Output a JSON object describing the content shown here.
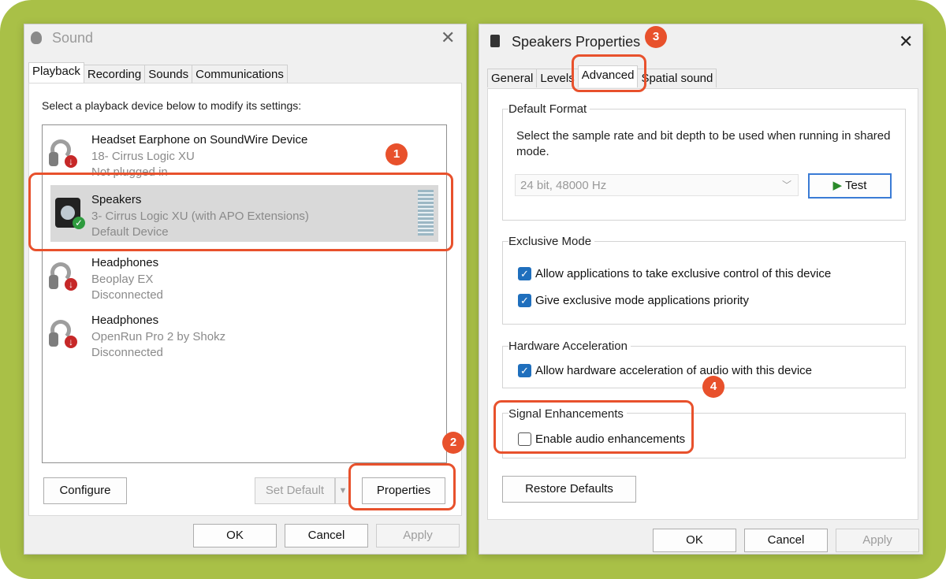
{
  "sound_window": {
    "title": "Sound",
    "tabs": [
      "Playback",
      "Recording",
      "Sounds",
      "Communications"
    ],
    "instruction": "Select a playback device below to modify its settings:",
    "devices": [
      {
        "name": "Headset Earphone on SoundWire Device",
        "line2": "18- Cirrus Logic XU",
        "line3": "Not plugged in"
      },
      {
        "name": "Speakers",
        "line2": "3- Cirrus Logic XU (with APO Extensions)",
        "line3": "Default Device"
      },
      {
        "name": "Headphones",
        "line2": "Beoplay EX",
        "line3": "Disconnected"
      },
      {
        "name": "Headphones",
        "line2": "OpenRun Pro 2 by Shokz",
        "line3": "Disconnected"
      }
    ],
    "buttons": {
      "configure": "Configure",
      "set_default": "Set Default",
      "properties": "Properties"
    },
    "footer": {
      "ok": "OK",
      "cancel": "Cancel",
      "apply": "Apply"
    }
  },
  "speakers_window": {
    "title": "Speakers Properties",
    "tabs": [
      "General",
      "Levels",
      "Advanced",
      "Spatial sound"
    ],
    "default_format": {
      "title": "Default Format",
      "description": "Select the sample rate and bit depth to be used when running in shared mode.",
      "selected": "24 bit, 48000 Hz",
      "test_button": "Test"
    },
    "exclusive_mode": {
      "title": "Exclusive Mode",
      "option1": "Allow applications to take exclusive control of this device",
      "option2": "Give exclusive mode applications priority"
    },
    "hardware_acceleration": {
      "title": "Hardware Acceleration",
      "option": "Allow hardware acceleration of audio with this device"
    },
    "signal_enhancements": {
      "title": "Signal Enhancements",
      "option": "Enable audio enhancements"
    },
    "restore_defaults": "Restore Defaults",
    "footer": {
      "ok": "OK",
      "cancel": "Cancel",
      "apply": "Apply"
    }
  },
  "callouts": [
    "1",
    "2",
    "3",
    "4"
  ],
  "colors": {
    "accent": "#e8512c",
    "check": "#1f6fbd",
    "background": "#a9c047"
  }
}
